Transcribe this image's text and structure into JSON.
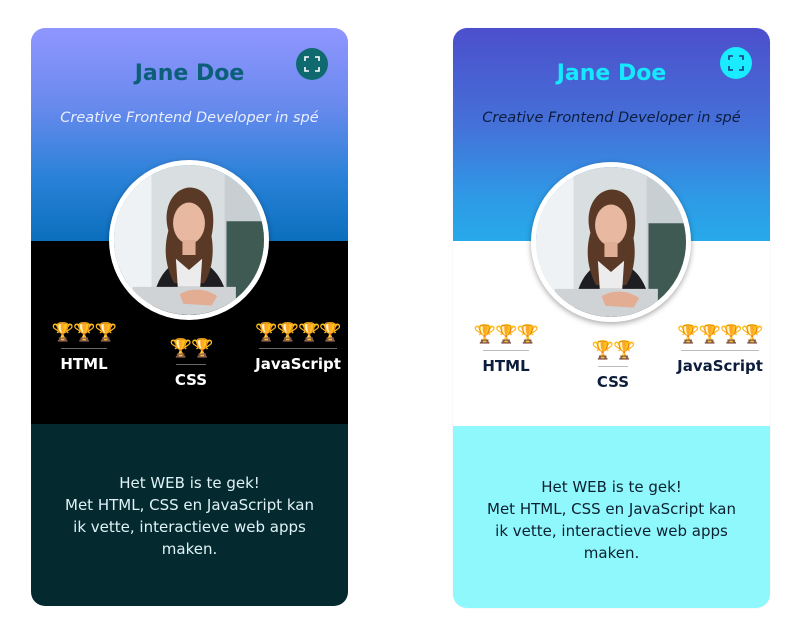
{
  "cards": [
    {
      "theme": "dark",
      "name": "Jane Doe",
      "subtitle": "Creative Frontend Developer in spé",
      "expand_icon": "expand-icon",
      "skills": [
        {
          "label": "HTML",
          "trophies": "🏆🏆🏆",
          "level": 3
        },
        {
          "label": "CSS",
          "trophies": "🏆🏆",
          "level": 2
        },
        {
          "label": "JavaScript",
          "trophies": "🏆🏆🏆🏆",
          "level": 4
        }
      ],
      "bio": {
        "line1": "Het WEB is te gek!",
        "line2": "Met HTML, CSS en JavaScript kan ik vette, interactieve web apps maken."
      },
      "colors": {
        "header_top": "#8f96ff",
        "header_bottom": "#0b6fbd",
        "middle": "#000000",
        "bottom": "#042a30",
        "name": "#0c5f78"
      }
    },
    {
      "theme": "light",
      "name": "Jane Doe",
      "subtitle": "Creative Frontend Developer in spé",
      "expand_icon": "expand-icon",
      "skills": [
        {
          "label": "HTML",
          "trophies": "🏆🏆🏆",
          "level": 3
        },
        {
          "label": "CSS",
          "trophies": "🏆🏆",
          "level": 2
        },
        {
          "label": "JavaScript",
          "trophies": "🏆🏆🏆🏆",
          "level": 4
        }
      ],
      "bio": {
        "line1": "Het WEB is te gek!",
        "line2": "Met HTML, CSS en JavaScript kan ik vette, interactieve web apps maken."
      },
      "colors": {
        "header_top": "#4c4fcc",
        "header_bottom": "#27a9ea",
        "middle": "#ffffff",
        "bottom": "#8ff8fc",
        "name": "#16e8ff"
      }
    }
  ]
}
